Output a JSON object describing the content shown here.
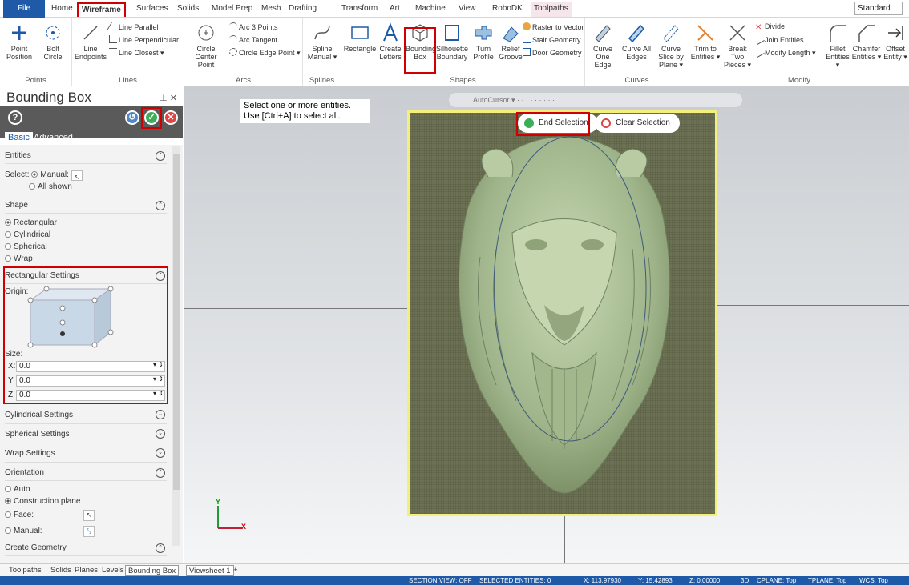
{
  "tabs": [
    "File",
    "Home",
    "Wireframe",
    "Surfaces",
    "Solids",
    "Model Prep",
    "Mesh",
    "Drafting",
    "Transform",
    "Art",
    "Machine",
    "View",
    "RoboDK",
    "Toolpaths"
  ],
  "workspace": "Standard",
  "ribbon": {
    "points": {
      "label": "Points",
      "point_position": "Point Position",
      "bolt_circle": "Bolt Circle"
    },
    "lines": {
      "label": "Lines",
      "line_endpoints": "Line Endpoints",
      "line_parallel": "Line Parallel",
      "line_perpendicular": "Line Perpendicular",
      "line_closest": "Line Closest"
    },
    "arcs": {
      "label": "Arcs",
      "circle_center_point": "Circle Center Point",
      "arc_3_points": "Arc 3 Points",
      "arc_tangent": "Arc Tangent",
      "circle_edge_point": "Circle Edge Point"
    },
    "splines": {
      "label": "Splines",
      "spline_manual": "Spline Manual"
    },
    "shapes": {
      "label": "Shapes",
      "rectangle": "Rectangle",
      "create_letters": "Create Letters",
      "bounding_box": "Bounding Box",
      "silhouette_boundary": "Silhouette Boundary",
      "turn_profile": "Turn Profile",
      "relief_groove": "Relief Groove",
      "raster_to_vector": "Raster to Vector",
      "stair_geometry": "Stair Geometry",
      "door_geometry": "Door Geometry"
    },
    "curves": {
      "label": "Curves",
      "curve_one_edge": "Curve One Edge",
      "curve_all_edges": "Curve All Edges",
      "curve_slice_by_plane": "Curve Slice by Plane"
    },
    "modify": {
      "label": "Modify",
      "trim_to_entities": "Trim to Entities",
      "break_two_pieces": "Break Two Pieces",
      "divide": "Divide",
      "join_entities": "Join Entities",
      "modify_length": "Modify Length",
      "fillet_entities": "Fillet Entities",
      "chamfer_entities": "Chamfer Entities",
      "offset_entity": "Offset Entity"
    }
  },
  "panel": {
    "title": "Bounding Box",
    "subtabs": [
      "Basic",
      "Advanced"
    ],
    "entities": {
      "header": "Entities",
      "select_label": "Select:",
      "manual": "Manual:",
      "all_shown": "All shown"
    },
    "shape": {
      "header": "Shape",
      "options": [
        "Rectangular",
        "Cylindrical",
        "Spherical",
        "Wrap"
      ],
      "selected": "Rectangular"
    },
    "rect_settings": {
      "header": "Rectangular Settings",
      "origin": "Origin:",
      "size": "Size:",
      "x_label": "X:",
      "x": "0.0",
      "y_label": "Y:",
      "y": "0.0",
      "z_label": "Z:",
      "z": "0.0"
    },
    "collapsed": [
      "Cylindrical Settings",
      "Spherical Settings",
      "Wrap Settings"
    ],
    "orientation": {
      "header": "Orientation",
      "auto": "Auto",
      "construction_plane": "Construction plane",
      "face": "Face:",
      "manual": "Manual:"
    },
    "create_geometry": "Create Geometry"
  },
  "viewport": {
    "prompt_line1": "Select one or more entities.",
    "prompt_line2": "Use [Ctrl+A] to select all.",
    "autocursor": "AutoCursor",
    "end_selection": "End Selection",
    "clear_selection": "Clear Selection",
    "axis_x": "X",
    "axis_y": "Y"
  },
  "bottom_tabs": [
    "Toolpaths",
    "Solids",
    "Planes",
    "Levels",
    "Bounding Box"
  ],
  "viewsheet": "Viewsheet 1",
  "viewsheet_add": "+",
  "status": {
    "section_view": "SECTION VIEW: OFF",
    "selected": "SELECTED ENTITIES: 0",
    "x": "X: 113.97930",
    "y": "Y: 15.42893",
    "z": "Z: 0.00000",
    "mode": "3D",
    "cplane": "CPLANE: Top",
    "tplane": "TPLANE: Top",
    "wcs": "WCS: Top"
  },
  "colors": {
    "accent": "#1e5aa8",
    "highlight": "#d00000",
    "ok": "#3cae5a",
    "cancel": "#e04444"
  }
}
